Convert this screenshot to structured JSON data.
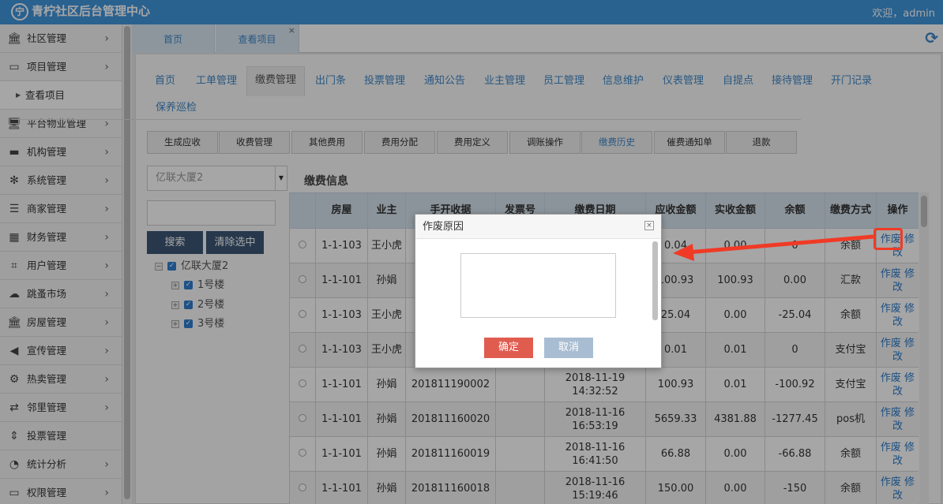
{
  "app": {
    "logo_glyph": "宁",
    "title": "青柠社区后台管理中心",
    "welcome": "欢迎，admin"
  },
  "sidebar": {
    "items": [
      {
        "label": "社区管理",
        "icon": "bank-icon",
        "glyph": "🏛"
      },
      {
        "label": "项目管理",
        "icon": "project-icon",
        "glyph": "▭"
      },
      {
        "label": "查看项目",
        "sub": true
      },
      {
        "label": "平台物业管理",
        "icon": "monitor-icon",
        "glyph": "🖥"
      },
      {
        "label": "机构管理",
        "icon": "stripe-icon",
        "glyph": "▬"
      },
      {
        "label": "系统管理",
        "icon": "yelp-icon",
        "glyph": "✻"
      },
      {
        "label": "商家管理",
        "icon": "bars-icon",
        "glyph": "☰"
      },
      {
        "label": "财务管理",
        "icon": "calculator-icon",
        "glyph": "▦"
      },
      {
        "label": "用户管理",
        "icon": "crop-icon",
        "glyph": "⌗"
      },
      {
        "label": "跳蚤市场",
        "icon": "cloud-icon",
        "glyph": "☁"
      },
      {
        "label": "房屋管理",
        "icon": "bank-icon",
        "glyph": "🏛"
      },
      {
        "label": "宣传管理",
        "icon": "volume-icon",
        "glyph": "◀"
      },
      {
        "label": "热卖管理",
        "icon": "gear-icon",
        "glyph": "⚙"
      },
      {
        "label": "邻里管理",
        "icon": "retweet-icon",
        "glyph": "⇄"
      },
      {
        "label": "投票管理",
        "icon": "sort-icon",
        "glyph": "⇕"
      },
      {
        "label": "统计分析",
        "icon": "pie-chart-icon",
        "glyph": "◔"
      },
      {
        "label": "权限管理",
        "icon": "credit-card-icon",
        "glyph": "▭"
      }
    ]
  },
  "tabs": [
    {
      "label": "首页"
    },
    {
      "label": "查看项目"
    }
  ],
  "module_tabs": [
    "首页",
    "工单管理",
    "缴费管理",
    "出门条",
    "投票管理",
    "通知公告",
    "业主管理",
    "员工管理",
    "信息维护",
    "仪表管理",
    "自提点",
    "接待管理",
    "开门记录",
    "保养巡检"
  ],
  "sub_tabs": [
    "生成应收",
    "收费管理",
    "其他费用",
    "费用分配",
    "费用定义",
    "调账操作",
    "缴费历史",
    "催费通知单",
    "退款"
  ],
  "filter": {
    "building": "亿联大厦2",
    "search_label": "搜索",
    "clear_label": "清除选中"
  },
  "tree": {
    "root": "亿联大厦2",
    "children": [
      "1号楼",
      "2号楼",
      "3号楼"
    ]
  },
  "section_title": "缴费信息",
  "table": {
    "headers": [
      "房屋",
      "业主",
      "手开收据",
      "发票号",
      "缴费日期",
      "应收金额",
      "实收金额",
      "余额",
      "缴费方式",
      "操作"
    ],
    "rows": [
      {
        "room": "1-1-103",
        "owner": "王小虎",
        "receipt": "",
        "invoice": "",
        "date": "",
        "due": "0.04",
        "paid": "0.00",
        "balance": "0",
        "method": "余额",
        "ops": "作废 修改"
      },
      {
        "room": "1-1-101",
        "owner": "孙娟",
        "receipt": "",
        "invoice": "",
        "date": "",
        "due": "100.93",
        "paid": "100.93",
        "balance": "0.00",
        "method": "汇款",
        "ops": "作废 修改"
      },
      {
        "room": "1-1-103",
        "owner": "王小虎",
        "receipt": "",
        "invoice": "",
        "date": "",
        "due": "25.04",
        "paid": "0.00",
        "balance": "-25.04",
        "method": "余额",
        "ops": "作废 修改"
      },
      {
        "room": "1-1-103",
        "owner": "王小虎",
        "receipt": "",
        "invoice": "",
        "date": "",
        "due": "0.01",
        "paid": "0.01",
        "balance": "0",
        "method": "支付宝",
        "ops": "作废 修改"
      },
      {
        "room": "1-1-101",
        "owner": "孙娟",
        "receipt": "201811190002",
        "invoice": "",
        "date": "2018-11-19 14:32:52",
        "due": "100.93",
        "paid": "0.01",
        "balance": "-100.92",
        "method": "支付宝",
        "ops": "作废 修改"
      },
      {
        "room": "1-1-101",
        "owner": "孙娟",
        "receipt": "201811160020",
        "invoice": "",
        "date": "2018-11-16 16:53:19",
        "due": "5659.33",
        "paid": "4381.88",
        "balance": "-1277.45",
        "method": "pos机",
        "ops": "作废 修改"
      },
      {
        "room": "1-1-101",
        "owner": "孙娟",
        "receipt": "201811160019",
        "invoice": "",
        "date": "2018-11-16 16:41:50",
        "due": "66.88",
        "paid": "0.00",
        "balance": "-66.88",
        "method": "余额",
        "ops": "作废 修改"
      },
      {
        "room": "1-1-101",
        "owner": "孙娟",
        "receipt": "201811160018",
        "invoice": "",
        "date": "2018-11-16 15:19:46",
        "due": "150.00",
        "paid": "0.00",
        "balance": "-150",
        "method": "余额",
        "ops": "作废 修改"
      }
    ]
  },
  "dialog": {
    "title": "作废原因",
    "ok": "确定",
    "cancel": "取消",
    "reason": ""
  }
}
